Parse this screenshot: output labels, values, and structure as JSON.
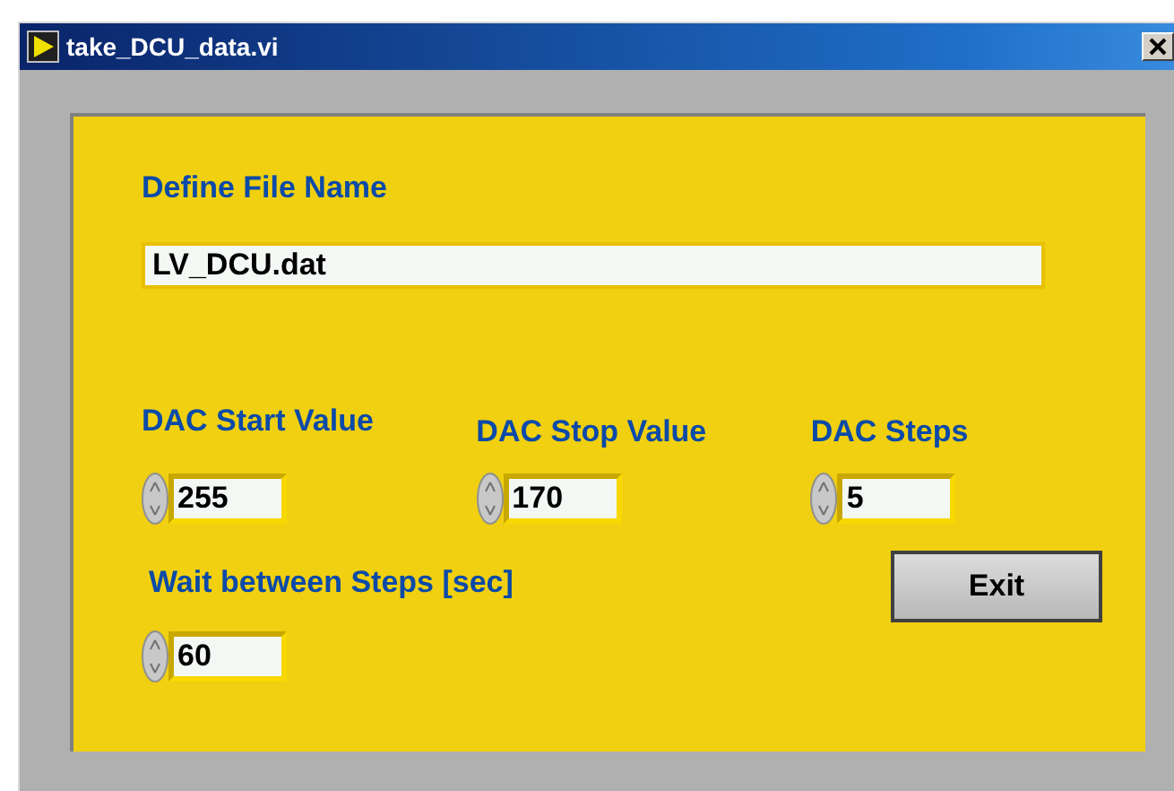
{
  "window": {
    "title": "take_DCU_data.vi"
  },
  "file_name": {
    "label": "Define File Name",
    "value": "LV_DCU.dat"
  },
  "numerics": [
    {
      "label": "DAC Start Value",
      "value": "255"
    },
    {
      "label": "DAC Stop Value",
      "value": "170"
    },
    {
      "label": "DAC Steps",
      "value": "5"
    }
  ],
  "wait": {
    "label": "Wait between Steps [sec]",
    "value": "60"
  },
  "buttons": [
    {
      "label": "Exit"
    }
  ]
}
